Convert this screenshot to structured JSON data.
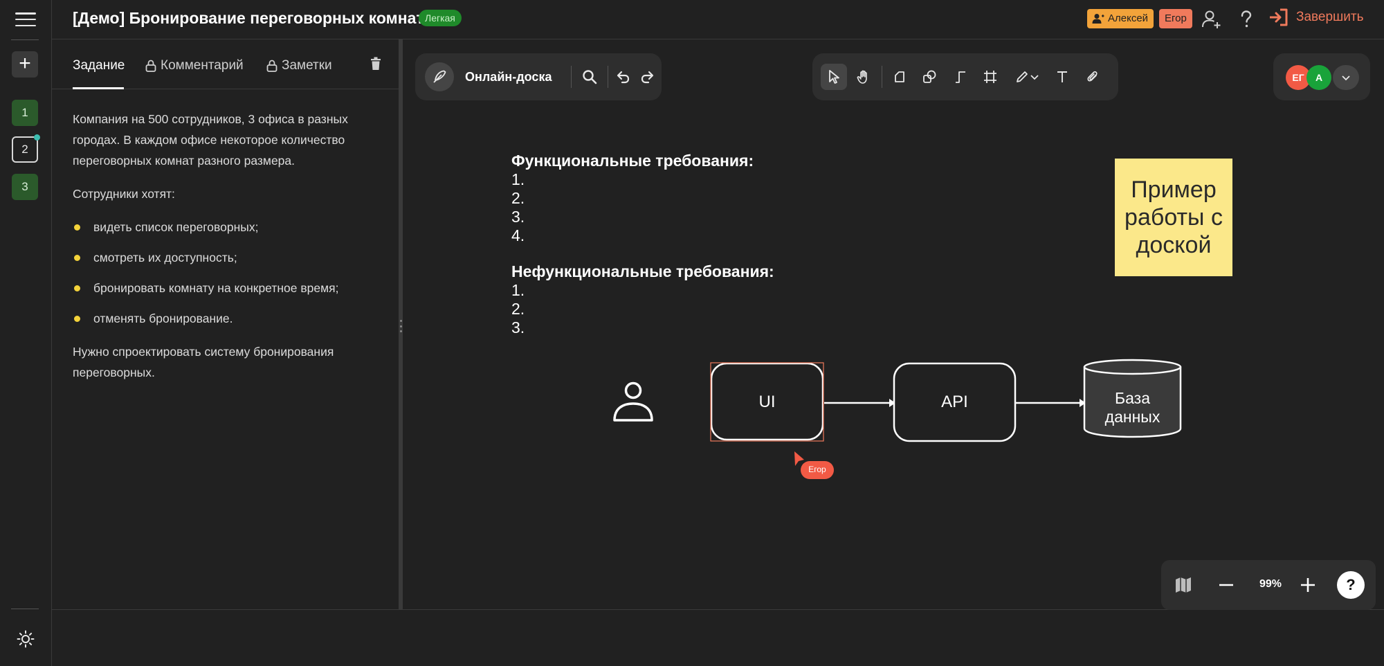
{
  "header": {
    "title": "[Демо] Бронирование переговорных комнат",
    "difficulty": "Легкая",
    "participants": [
      "Алексей",
      "Егор"
    ],
    "finish_label": "Завершить"
  },
  "rail": {
    "steps": [
      "1",
      "2",
      "3"
    ],
    "active_step": "2"
  },
  "panel": {
    "tabs": [
      "Задание",
      "Комментарий",
      "Заметки"
    ],
    "active_tab": "Задание",
    "task": {
      "intro": "Компания на 500 сотрудников, 3 офиса в разных городах. В каждом офисе некоторое количество переговорных комнат разного размера.",
      "wants_label": "Сотрудники хотят:",
      "wants": [
        "видеть список переговорных;",
        "смотреть их доступность;",
        "бронировать комнату на конкретное время;",
        "отменять бронирование."
      ],
      "goal": "Нужно спроектировать систему бронирования переговорных."
    }
  },
  "board": {
    "toolbar_label": "Онлайн-доска",
    "avatars": [
      "ЕГ",
      "А"
    ],
    "functional_heading": "Функциональные требования:",
    "functional_items": [
      "1.",
      "2.",
      "3.",
      "4."
    ],
    "nonfunctional_heading": "Нефункциональные требования:",
    "nonfunctional_items": [
      "1.",
      "2.",
      "3."
    ],
    "sticky_note": "Пример работы с доской",
    "diagram": {
      "ui_label": "UI",
      "api_label": "API",
      "db_label_line1": "База",
      "db_label_line2": "данных"
    },
    "cursor_user": "Егор",
    "zoom": "99%",
    "help": "?"
  },
  "colors": {
    "background": "#212121",
    "panel": "#2e2e2e",
    "accent_orange": "#f07a5c",
    "badge_green": "#1f8a2a",
    "sticky_yellow": "#fbe88a",
    "bullet_yellow": "#f4d33a"
  }
}
